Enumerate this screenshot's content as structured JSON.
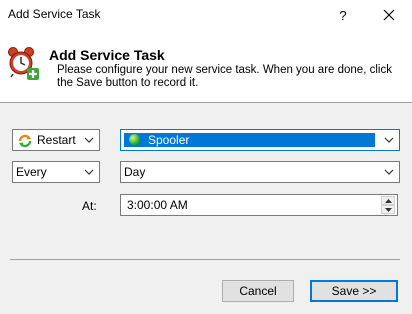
{
  "window": {
    "title": "Add Service Task",
    "help_label": "?"
  },
  "header": {
    "title": "Add Service Task",
    "description": "Please configure your new service task. When you are done, click the Save button to record it.",
    "icon": "alarm-clock-add-icon"
  },
  "form": {
    "action": {
      "value": "Restart",
      "icon": "restart-icon"
    },
    "service": {
      "value": "Spooler",
      "status_color": "#30b020",
      "icon": "service-status-icon"
    },
    "frequency": {
      "value": "Every"
    },
    "period": {
      "value": "Day"
    },
    "time": {
      "label": "At:",
      "value": "3:00:00 AM"
    }
  },
  "buttons": {
    "cancel": "Cancel",
    "save": "Save >>"
  },
  "colors": {
    "accent": "#0078d7",
    "background": "#f0f0f0"
  }
}
